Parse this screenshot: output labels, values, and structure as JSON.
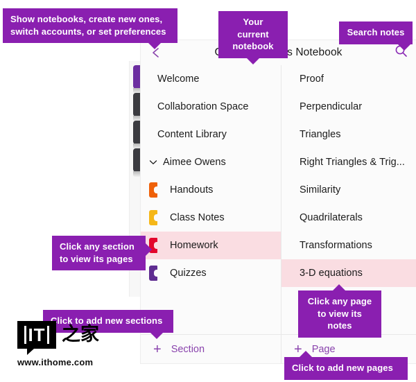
{
  "app": {
    "title": "Geometry Class Notebook",
    "back_icon": "back-chevron-icon",
    "search_icon": "search-icon"
  },
  "sections_panel": {
    "items": [
      {
        "label": "Welcome",
        "type": "top",
        "color": "",
        "selected": false
      },
      {
        "label": "Collaboration Space",
        "type": "top",
        "color": "",
        "selected": false
      },
      {
        "label": "Content Library",
        "type": "top",
        "color": "",
        "selected": false
      },
      {
        "label": "Aimee Owens",
        "type": "group",
        "color": "",
        "selected": false
      },
      {
        "label": "Handouts",
        "type": "child",
        "color": "#ef6109",
        "selected": false
      },
      {
        "label": "Class Notes",
        "type": "child",
        "color": "#f5b718",
        "selected": false
      },
      {
        "label": "Homework",
        "type": "child",
        "color": "#e3072c",
        "selected": true
      },
      {
        "label": "Quizzes",
        "type": "child",
        "color": "#5f2d91",
        "selected": false
      }
    ],
    "add_label": "Section",
    "add_icon": "plus-icon"
  },
  "pages_panel": {
    "items": [
      {
        "label": "Proof",
        "selected": false
      },
      {
        "label": "Perpendicular",
        "selected": false
      },
      {
        "label": "Triangles",
        "selected": false
      },
      {
        "label": "Right Triangles & Trig...",
        "selected": false
      },
      {
        "label": "Similarity",
        "selected": false
      },
      {
        "label": "Quadrilaterals",
        "selected": false
      },
      {
        "label": "Transformations",
        "selected": false
      },
      {
        "label": "3-D equations",
        "selected": true
      }
    ],
    "add_label": "Page",
    "add_icon": "plus-icon"
  },
  "callouts": {
    "notebooks": "Show notebooks, create new ones, switch accounts, or set preferences",
    "current_notebook": "Your current notebook",
    "search": "Search notes",
    "section": "Click any section to view its pages",
    "add_sections": "Click to add new sections",
    "page": "Click any page to view its notes",
    "add_pages": "Click to add new pages"
  },
  "watermark": {
    "badge": "IT",
    "cjk": "之家",
    "url": "www.ithome.com"
  },
  "colors": {
    "callout_purple": "#8a1fb0",
    "accent_purple": "#8a44ad",
    "selected_pink": "#fadde2",
    "panel_bg": "#fbfbfb"
  }
}
